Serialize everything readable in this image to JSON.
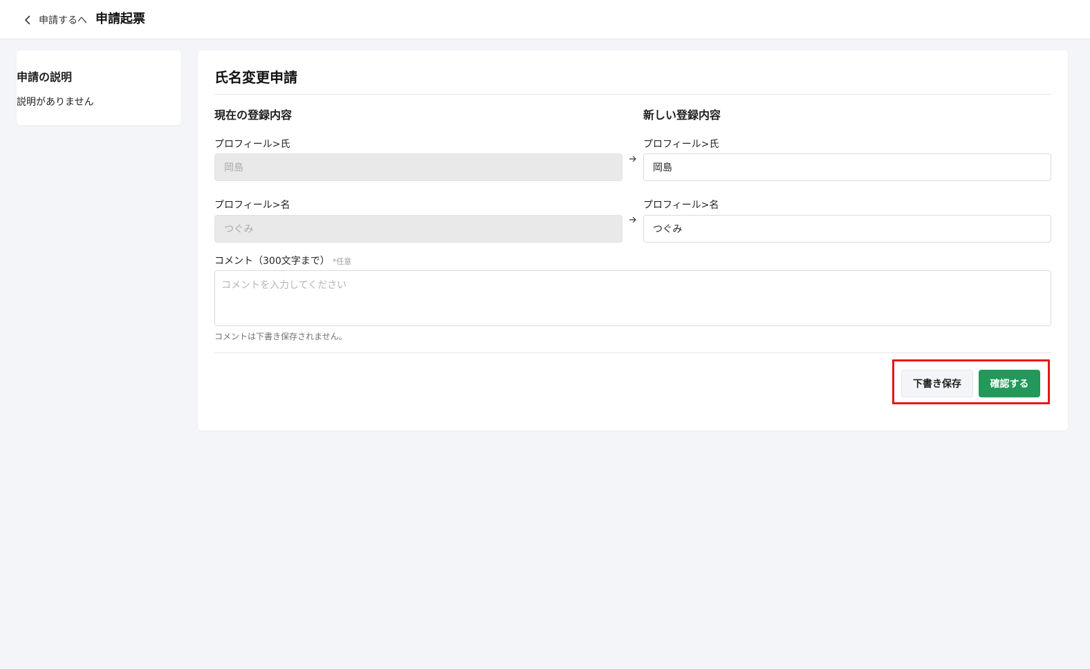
{
  "header": {
    "back_label": "申請するへ",
    "page_title": "申請起票"
  },
  "sidebar": {
    "title": "申請の説明",
    "text": "説明がありません"
  },
  "form": {
    "title": "氏名変更申請",
    "current_heading": "現在の登録内容",
    "new_heading": "新しい登録内容",
    "fields": [
      {
        "label": "プロフィール>氏",
        "current_value": "岡島",
        "new_value": "岡島"
      },
      {
        "label": "プロフィール>名",
        "current_value": "つぐみ",
        "new_value": "つぐみ"
      }
    ],
    "comment": {
      "label": "コメント（300文字まで）",
      "optional_mark": "*任意",
      "placeholder": "コメントを入力してください",
      "hint": "コメントは下書き保存されません。"
    },
    "actions": {
      "draft_label": "下書き保存",
      "confirm_label": "確認する"
    }
  },
  "colors": {
    "accent_green": "#22985a",
    "highlight_red": "#e8141c",
    "background": "#f4f5f8"
  }
}
